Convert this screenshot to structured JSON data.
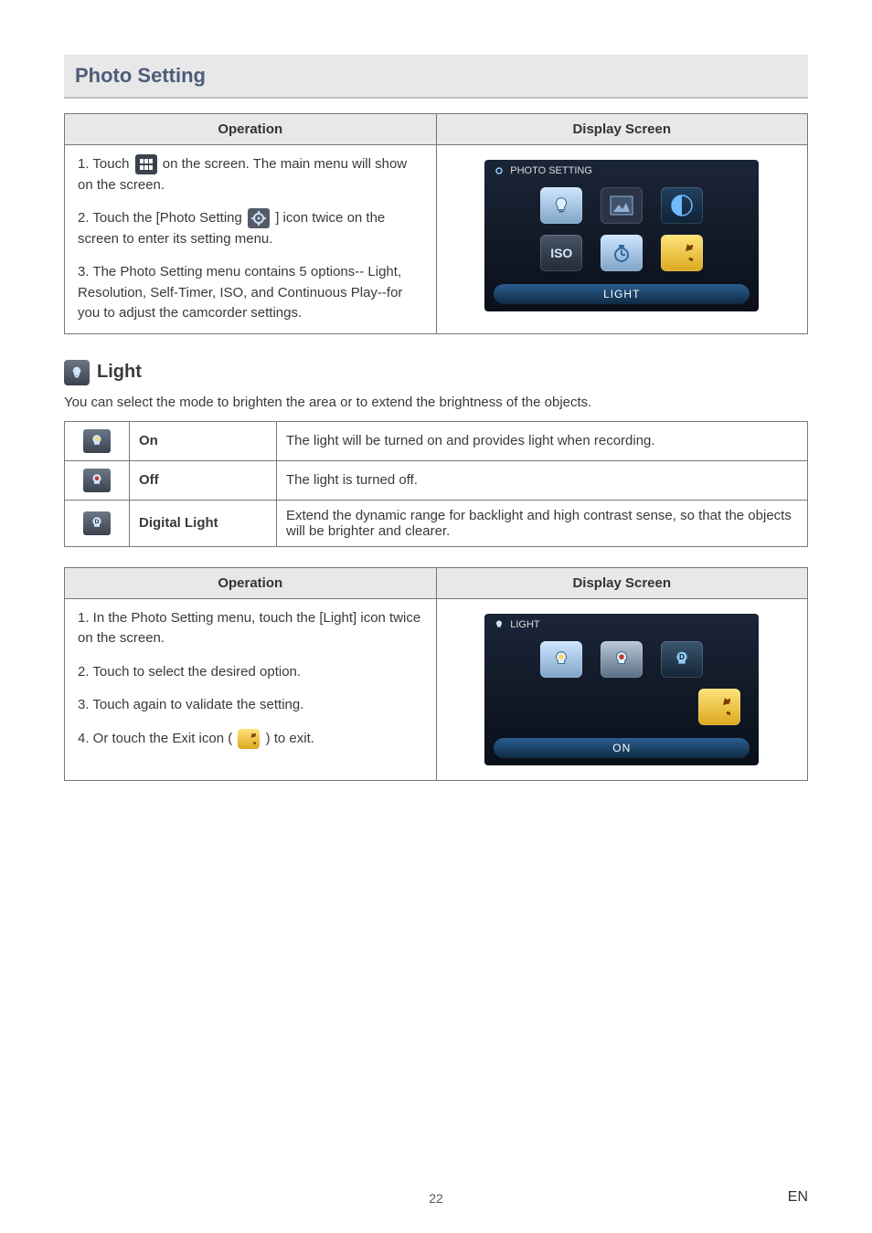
{
  "section_title": "Photo Setting",
  "table1": {
    "col_operation": "Operation",
    "col_display": "Display Screen",
    "step1a": "1.  Touch ",
    "step1b": " on the screen. The main menu will show on the screen.",
    "step2a": "2.  Touch the [Photo Setting ",
    "step2b": " ] icon twice on the screen to enter its setting menu.",
    "step3": "3.  The Photo Setting menu contains 5 options-- Light, Resolution, Self-Timer, ISO, and Continuous Play--for you to adjust the camcorder settings."
  },
  "screen1": {
    "title": "PHOTO SETTING",
    "iso_label": "ISO",
    "bottom": "LIGHT"
  },
  "subheading": "Light",
  "intro": "You can select the mode to brighten the area or to extend the brightness of the objects.",
  "options": {
    "on_label": "On",
    "on_desc": "The light will be turned on and provides light when recording.",
    "off_label": "Off",
    "off_desc": "The light is turned off.",
    "digital_label": "Digital Light",
    "digital_desc": "Extend the dynamic range for backlight and high contrast sense, so that the objects will be brighter and clearer."
  },
  "table2": {
    "col_operation": "Operation",
    "col_display": "Display Screen",
    "step1": "1.  In the Photo Setting menu, touch the [Light] icon twice on the screen.",
    "step2": "2.  Touch to select the desired option.",
    "step3": "3.  Touch again to validate the setting.",
    "step4a": "4.  Or touch the Exit icon ( ",
    "step4b": " ) to exit."
  },
  "screen2": {
    "title": "LIGHT",
    "d_label": "D",
    "bottom": "ON"
  },
  "page_number": "22",
  "lang": "EN"
}
